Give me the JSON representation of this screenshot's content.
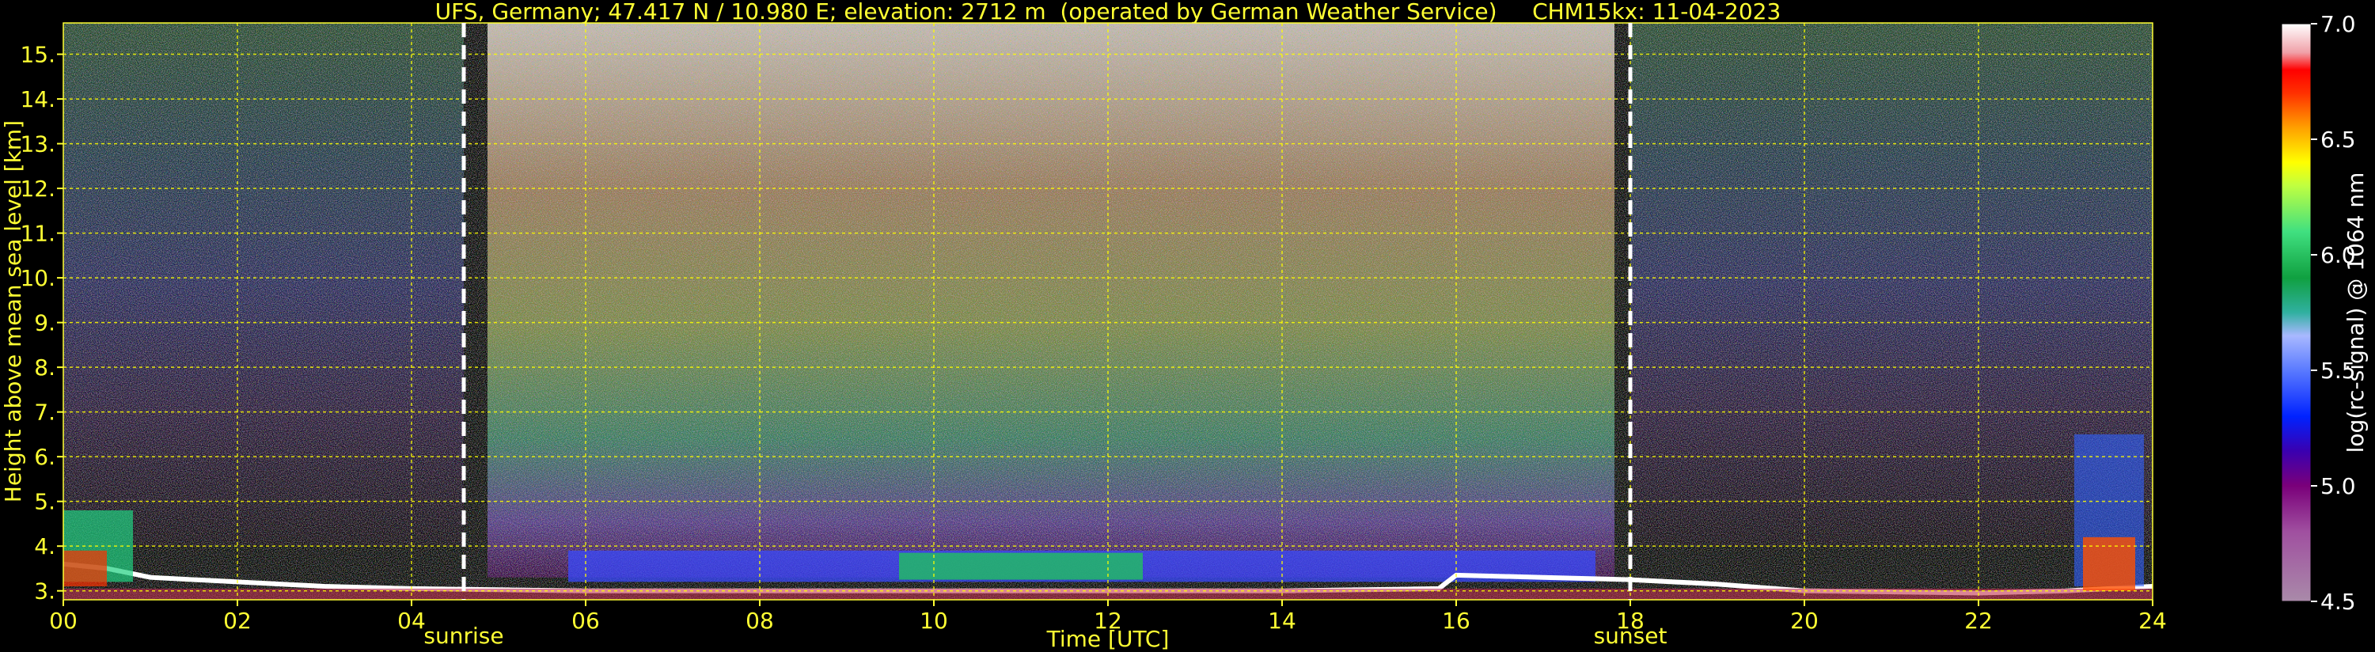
{
  "chart_data": {
    "type": "heatmap",
    "title": "UFS, Germany; 47.417 N / 10.980 E; elevation: 2712 m  (operated by German Weather Service)     CHM15kx: 11-04-2023",
    "xlabel": "Time [UTC]",
    "ylabel": "Height above mean sea level [km]",
    "xlim": [
      0,
      24
    ],
    "ylim": [
      2.8,
      15.7
    ],
    "x_ticks": [
      "00",
      "02",
      "04",
      "06",
      "08",
      "10",
      "12",
      "14",
      "16",
      "18",
      "20",
      "22",
      "24"
    ],
    "y_ticks": [
      "3.",
      "4.",
      "5.",
      "6.",
      "7.",
      "8.",
      "9.",
      "10.",
      "11.",
      "12.",
      "13.",
      "14.",
      "15."
    ],
    "grid": true,
    "colorbar": {
      "label": "log(rc-signal) @ 1064 nm",
      "range": [
        4.5,
        7.0
      ],
      "ticks": [
        "7.0",
        "6.5",
        "6.0",
        "5.5",
        "5.0",
        "4.5"
      ]
    },
    "markers": [
      {
        "label": "sunrise",
        "time": 4.6
      },
      {
        "label": "sunset",
        "time": 18.0
      }
    ],
    "features": {
      "daytime_background_start": 4.6,
      "daytime_background_end": 18.0,
      "boundary_layer_top_km": [
        [
          0.0,
          3.6
        ],
        [
          0.5,
          3.5
        ],
        [
          1.0,
          3.3
        ],
        [
          2.0,
          3.2
        ],
        [
          3.0,
          3.1
        ],
        [
          4.0,
          3.05
        ],
        [
          6.0,
          3.0
        ],
        [
          10.0,
          3.0
        ],
        [
          14.0,
          3.0
        ],
        [
          15.8,
          3.05
        ],
        [
          16.0,
          3.35
        ],
        [
          17.0,
          3.3
        ],
        [
          18.0,
          3.25
        ],
        [
          19.0,
          3.15
        ],
        [
          20.0,
          3.0
        ],
        [
          22.0,
          2.95
        ],
        [
          23.0,
          3.0
        ],
        [
          24.0,
          3.1
        ]
      ],
      "daytime_layer_km": [
        3.2,
        3.9
      ]
    }
  }
}
